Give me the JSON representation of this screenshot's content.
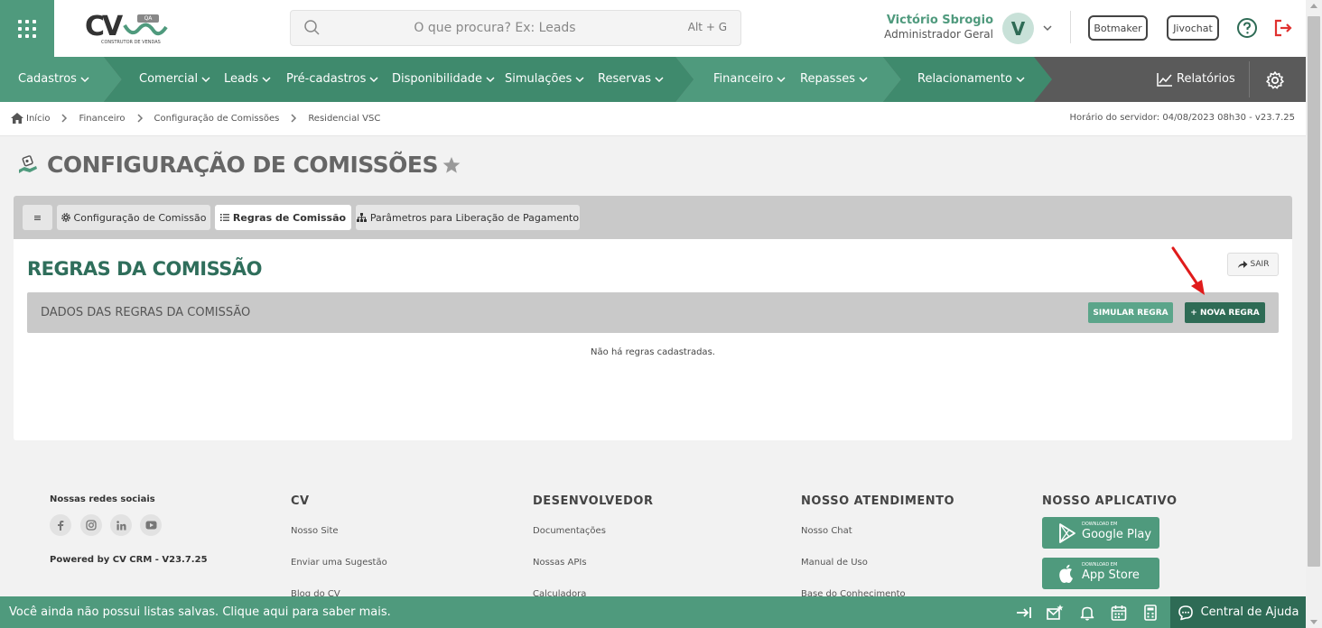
{
  "header": {
    "logo": {
      "text": "CV",
      "badge": "QA",
      "subtitle": "CONSTRUTOR DE VENDAS"
    },
    "search": {
      "placeholder": "O que procura? Ex: Leads",
      "shortcut": "Alt + G"
    },
    "user": {
      "name": "Victório Sbrogio",
      "role": "Administrador Geral",
      "initial": "V"
    },
    "buttons": {
      "botmaker": "Botmaker",
      "jivochat": "Jivochat"
    }
  },
  "nav": {
    "items": [
      "Cadastros",
      "Comercial",
      "Leads",
      "Pré-cadastros",
      "Disponibilidade",
      "Simulações",
      "Reservas",
      "Financeiro",
      "Repasses",
      "Relacionamento"
    ],
    "reports": "Relatórios",
    "colors": {
      "cadastros": "#4f9a7d",
      "comercial": "#3f8a6d",
      "financeiro": "#4f9a7d",
      "relacionamento": "#3f8a6d",
      "base": "#5a5a5a"
    }
  },
  "breadcrumb": {
    "items": [
      "Início",
      "Financeiro",
      "Configuração de Comissões",
      "Residencial VSC"
    ],
    "server_time": "Horário do servidor: 04/08/2023 08h30 - v23.7.25"
  },
  "page": {
    "title": "CONFIGURAÇÃO DE COMISSÕES"
  },
  "tabs": {
    "menu": "≡",
    "items": [
      "Configuração de Comissão",
      "Regras de Comissão",
      "Parâmetros para Liberação de Pagamento"
    ],
    "active": "Regras de Comissão"
  },
  "section": {
    "title": "REGRAS DA COMISSÃO",
    "exit": "SAIR",
    "data_title": "DADOS DAS REGRAS DA COMISSÃO",
    "simulate": "SIMULAR REGRA",
    "new_rule": "+ NOVA REGRA",
    "empty": "Não há regras cadastradas."
  },
  "footer": {
    "social_title": "Nossas redes sociais",
    "social_icons": [
      "facebook-icon",
      "instagram-icon",
      "linkedin-icon",
      "youtube-icon"
    ],
    "powered": "Powered by CV CRM - V23.7.25",
    "columns": [
      {
        "title": "CV",
        "links": [
          "Nosso Site",
          "Enviar uma Sugestão",
          "Blog do CV"
        ]
      },
      {
        "title": "DESENVOLVEDOR",
        "links": [
          "Documentações",
          "Nossas APIs",
          "Calculadora"
        ]
      },
      {
        "title": "NOSSO ATENDIMENTO",
        "links": [
          "Nosso Chat",
          "Manual de Uso",
          "Base do Conhecimento"
        ]
      },
      {
        "title": "NOSSO APLICATIVO",
        "links": []
      }
    ],
    "stores": [
      {
        "small": "DOWNLOAD EM",
        "big": "Google Play"
      },
      {
        "small": "DOWNLOAD EM",
        "big": "App Store"
      }
    ]
  },
  "bottombar": {
    "message": "Você ainda não possui listas salvas. Clique aqui para saber mais.",
    "help": "Central de Ajuda"
  }
}
